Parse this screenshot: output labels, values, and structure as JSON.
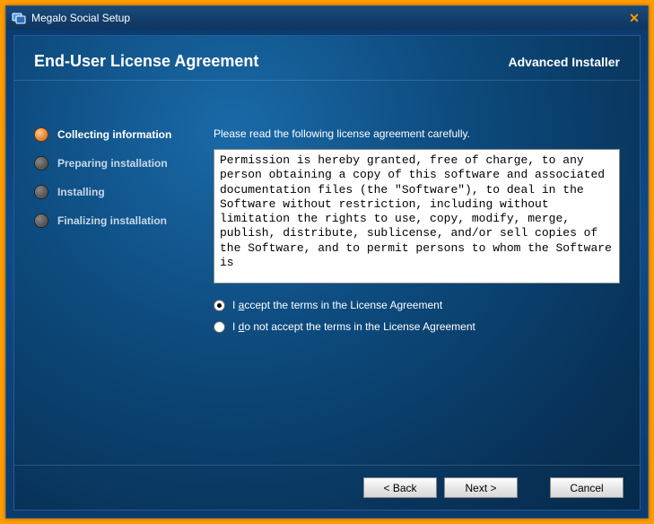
{
  "titlebar": {
    "title": "Megalo Social Setup"
  },
  "header": {
    "title": "End-User License Agreement",
    "brand": "Advanced Installer"
  },
  "steps": [
    {
      "label": "Collecting information",
      "active": true
    },
    {
      "label": "Preparing installation",
      "active": false
    },
    {
      "label": "Installing",
      "active": false
    },
    {
      "label": "Finalizing installation",
      "active": false
    }
  ],
  "main": {
    "instruction": "Please read the following license agreement carefully.",
    "license_text": "Permission is hereby granted, free of charge, to any person obtaining a copy of this software and associated documentation files (the \"Software\"), to deal in the Software without restriction, including without limitation the rights to use, copy, modify, merge, publish, distribute, sublicense, and/or sell copies of the Software, and to permit persons to whom the Software is ",
    "radios": {
      "accept_prefix": "I ",
      "accept_hot": "a",
      "accept_rest": "ccept the terms in the License Agreement",
      "decline_prefix": "I ",
      "decline_hot": "d",
      "decline_rest": "o not accept the terms in the License Agreement",
      "accept_checked": true
    }
  },
  "footer": {
    "back": "< Back",
    "next": "Next >",
    "cancel": "Cancel"
  }
}
